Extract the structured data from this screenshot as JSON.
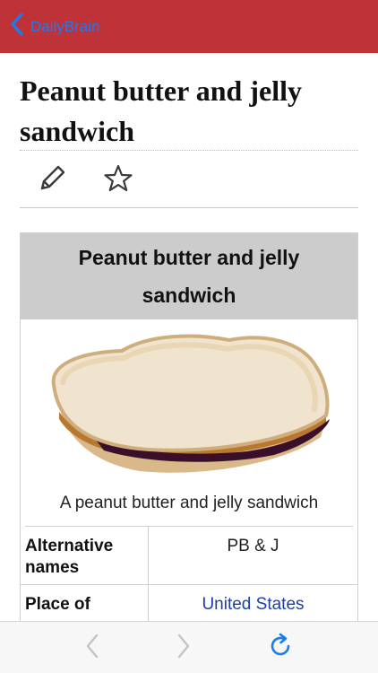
{
  "navbar": {
    "back_label": "DailyBrain",
    "background": "#bf3238",
    "accent": "#1a7cf0",
    "back_icon": "chevron-left-icon"
  },
  "article": {
    "title": "Peanut butter and jelly sandwich",
    "toolbar": {
      "edit_icon": "pencil-icon",
      "favorite_icon": "star-icon"
    }
  },
  "infobox": {
    "title": "Peanut butter and jelly sandwich",
    "image_caption": "A peanut butter and jelly sandwich",
    "rows": [
      {
        "key": "Alternative names",
        "value": "PB & J",
        "is_link": false
      },
      {
        "key": "Place of",
        "value": "United States",
        "is_link": true
      }
    ],
    "link_color": "#1a3fa6"
  },
  "bottombar": {
    "back_icon": "chevron-left-icon",
    "forward_icon": "chevron-right-icon",
    "refresh_icon": "refresh-icon",
    "disabled_color": "#c4c4c8",
    "active_color": "#1a7cf0"
  }
}
